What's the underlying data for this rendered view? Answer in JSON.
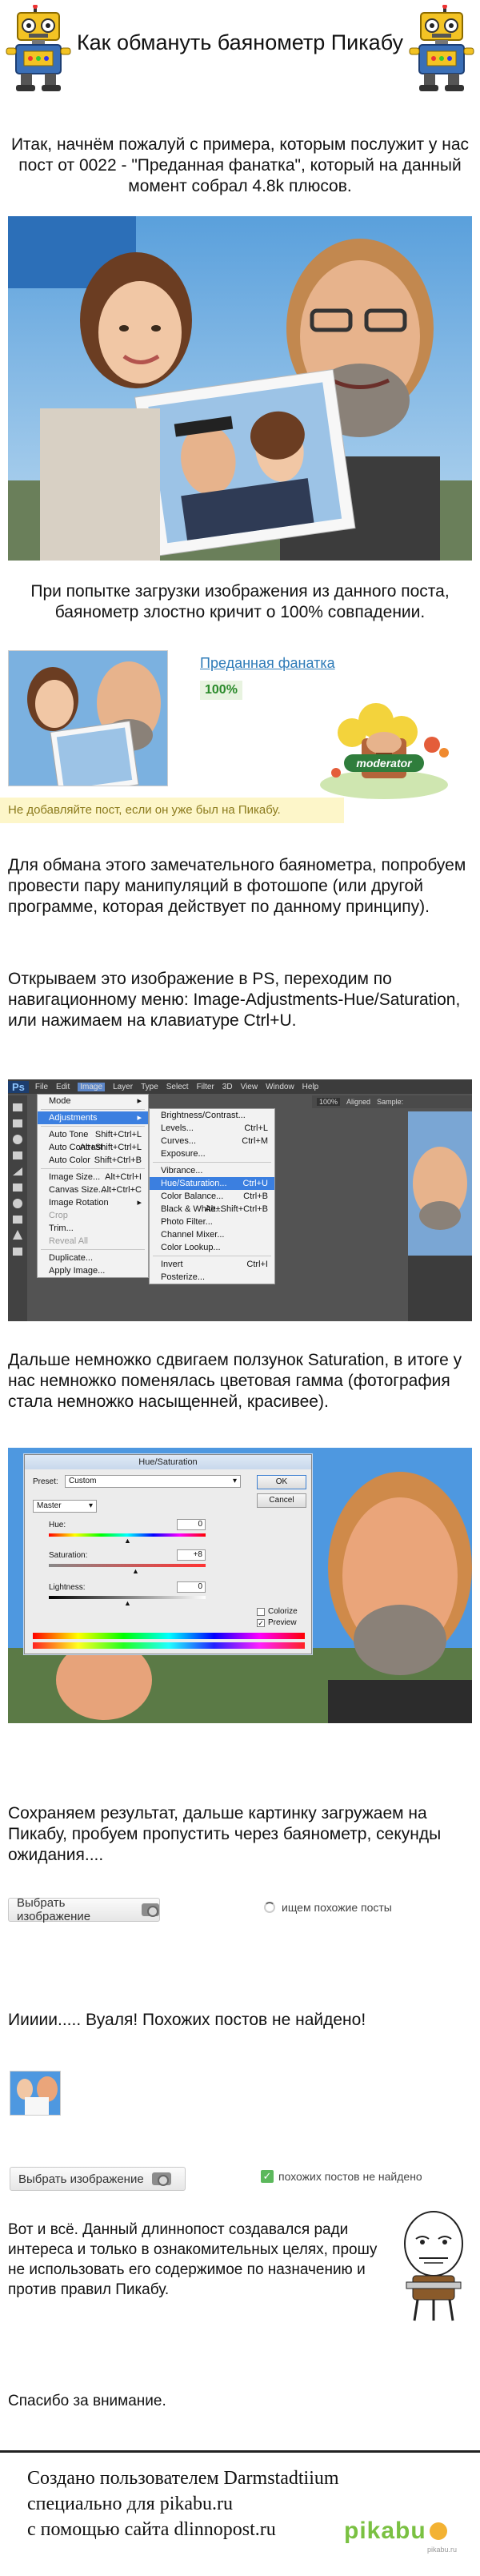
{
  "header": {
    "title": "Как обмануть баянометр Пикабу"
  },
  "intro": {
    "text": "Итак, начнём пожалуй с примера, которым послужит у нас пост от 0022 - \"Преданная фанатка\", который на данный момент собрал 4.8k плюсов."
  },
  "step1": {
    "text": "При попытке загрузки изображения из данного поста, баянометр злостно кричит о 100% совпадении."
  },
  "bayan_result": {
    "post_title": "Преданная фанатка",
    "match_percent": "100%",
    "moderator_label": "moderator",
    "warning": "Не добавляйте пост, если он уже был на Пикабу."
  },
  "step2": {
    "text": "Для обмана этого замечательного баянометра, попробуем провести пару манипуляций в фотошопе (или другой программе, которая действует по данному принципу)."
  },
  "step3": {
    "text": "Открываем это изображение в PS, переходим по навигационному меню: Image-Adjustments-Hue/Saturation, или нажимаем на клавиатуре Ctrl+U."
  },
  "photoshop": {
    "logo": "Ps",
    "menubar": [
      "File",
      "Edit",
      "Image",
      "Layer",
      "Type",
      "Select",
      "Filter",
      "3D",
      "View",
      "Window",
      "Help"
    ],
    "image_menu": [
      {
        "label": "Mode",
        "shortcut": "",
        "state": "normal"
      },
      {
        "label": "Adjustments",
        "shortcut": "",
        "state": "selected"
      },
      {
        "label": "Auto Tone",
        "shortcut": "Shift+Ctrl+L",
        "state": "normal"
      },
      {
        "label": "Auto Contrast",
        "shortcut": "Alt+Shift+Ctrl+L",
        "state": "normal"
      },
      {
        "label": "Auto Color",
        "shortcut": "Shift+Ctrl+B",
        "state": "normal"
      },
      {
        "label": "Image Size...",
        "shortcut": "Alt+Ctrl+I",
        "state": "normal"
      },
      {
        "label": "Canvas Size...",
        "shortcut": "Alt+Ctrl+C",
        "state": "normal"
      },
      {
        "label": "Image Rotation",
        "shortcut": "",
        "state": "normal"
      },
      {
        "label": "Crop",
        "shortcut": "",
        "state": "disabled"
      },
      {
        "label": "Trim...",
        "shortcut": "",
        "state": "normal"
      },
      {
        "label": "Reveal All",
        "shortcut": "",
        "state": "disabled"
      },
      {
        "label": "Duplicate...",
        "shortcut": "",
        "state": "normal"
      },
      {
        "label": "Apply Image...",
        "shortcut": "",
        "state": "normal"
      }
    ],
    "adjust_menu": [
      {
        "label": "Brightness/Contrast...",
        "shortcut": "",
        "state": "normal"
      },
      {
        "label": "Levels...",
        "shortcut": "Ctrl+L",
        "state": "normal"
      },
      {
        "label": "Curves...",
        "shortcut": "Ctrl+M",
        "state": "normal"
      },
      {
        "label": "Exposure...",
        "shortcut": "",
        "state": "normal"
      },
      {
        "label": "Vibrance...",
        "shortcut": "",
        "state": "normal"
      },
      {
        "label": "Hue/Saturation...",
        "shortcut": "Ctrl+U",
        "state": "selected"
      },
      {
        "label": "Color Balance...",
        "shortcut": "Ctrl+B",
        "state": "normal"
      },
      {
        "label": "Black & White...",
        "shortcut": "Alt+Shift+Ctrl+B",
        "state": "normal"
      },
      {
        "label": "Photo Filter...",
        "shortcut": "",
        "state": "normal"
      },
      {
        "label": "Channel Mixer...",
        "shortcut": "",
        "state": "normal"
      },
      {
        "label": "Color Lookup...",
        "shortcut": "",
        "state": "normal"
      },
      {
        "label": "Invert",
        "shortcut": "Ctrl+I",
        "state": "normal"
      },
      {
        "label": "Posterize...",
        "shortcut": "",
        "state": "normal"
      }
    ],
    "options_bar": {
      "zoom": "100%",
      "auto_select": "Aligned",
      "sample": "Sample:"
    }
  },
  "step4": {
    "text": "Дальше немножко сдвигаем ползунок Saturation, в итоге у нас немножко поменялась цветовая гамма (фотография стала немножко насыщенней, красивее)."
  },
  "hue_dialog": {
    "title": "Hue/Saturation",
    "preset_label": "Preset:",
    "preset_value": "Custom",
    "channel": "Master",
    "hue_label": "Hue:",
    "hue_value": "0",
    "saturation_label": "Saturation:",
    "saturation_value": "+8",
    "lightness_label": "Lightness:",
    "lightness_value": "0",
    "ok": "OK",
    "cancel": "Cancel",
    "colorize": "Colorize",
    "preview": "Preview"
  },
  "step5": {
    "text": "Сохраняем результат, дальше картинку загружаем на Пикабу, пробуем пропустить через баянометр, секунды ожидания...."
  },
  "upload1": {
    "button": "Выбрать изображение",
    "status": "ищем похожие посты"
  },
  "step6": {
    "text": "Иииии..... Вуаля! Похожих постов не найдено!"
  },
  "upload2": {
    "button": "Выбрать изображение",
    "status": "похожих постов не найдено"
  },
  "conclusion": {
    "text": "Вот и всё. Данный длиннопост создавался ради интереса и только в ознакомительных целях, прошу не использовать его содержимое по назначению и против правил Пикабу.",
    "thanks": "Спасибо за внимание."
  },
  "footer": {
    "line1": "Создано пользователем Darmstadtiium",
    "line2": "специально для pikabu.ru",
    "line3": "с помощью сайта dlinnopost.ru",
    "logo": "pikabu",
    "logo_sub": "pikabu.ru"
  },
  "colors": {
    "link": "#2e7bb8",
    "match_green": "#2a8a2a",
    "warning_bg": "#fdf6c9",
    "ps_bg": "#535353",
    "ps_selected": "#3b7fe0",
    "footer_border": "#222222",
    "pikabu_green": "#7ac142"
  }
}
